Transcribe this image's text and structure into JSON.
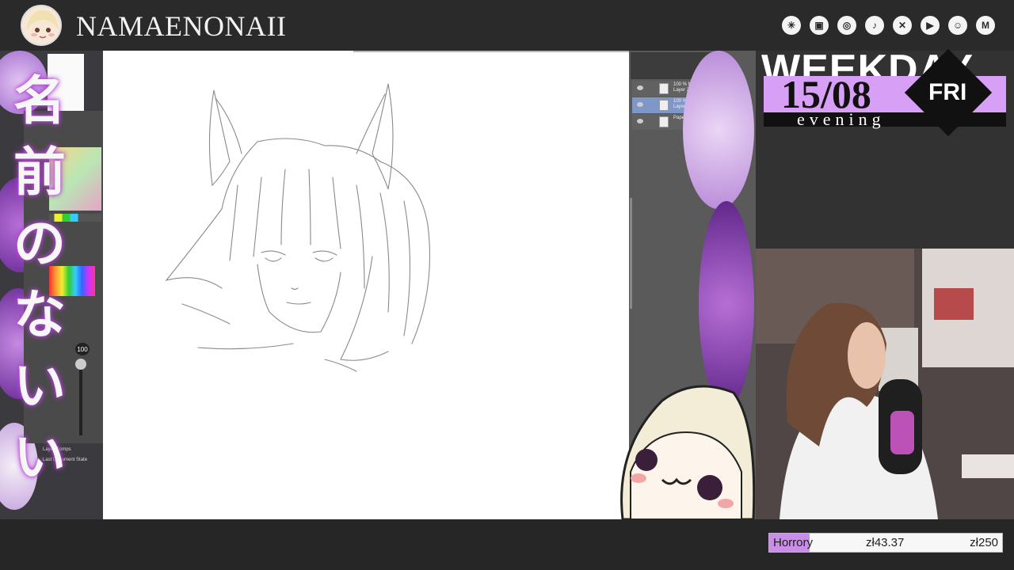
{
  "header": {
    "channel_name": "NAMAENONAII",
    "social_icons": [
      "linktree-icon",
      "twitch-icon",
      "instagram-icon",
      "tiktok-icon",
      "x-icon",
      "youtube-icon",
      "discord-icon",
      "mail-icon"
    ]
  },
  "sidebar": {
    "japanese_title": [
      "名",
      "前",
      "の",
      "な",
      "い",
      "い"
    ],
    "brush_size": "100",
    "layer_comps_label": "Layer Comps",
    "last_state_label": "Last Document State"
  },
  "layers": [
    {
      "label": "100 % Normal",
      "name": "Layer 2",
      "active": false
    },
    {
      "label": "100 % Normal",
      "name": "Layer 1",
      "active": true
    },
    {
      "label": "",
      "name": "Paper",
      "active": false
    }
  ],
  "schedule": {
    "weekday_label": "WEEKDAY",
    "date": "15/08",
    "day": "FRI",
    "time_of_day": "evening"
  },
  "goal": {
    "name": "Horrory",
    "current": "zł43.37",
    "target": "zł250",
    "progress_fraction": 0.1735
  },
  "colors": {
    "accent": "#d79ff5",
    "goal_fill": "#c98ee8",
    "topbar": "#2a2a2a"
  }
}
